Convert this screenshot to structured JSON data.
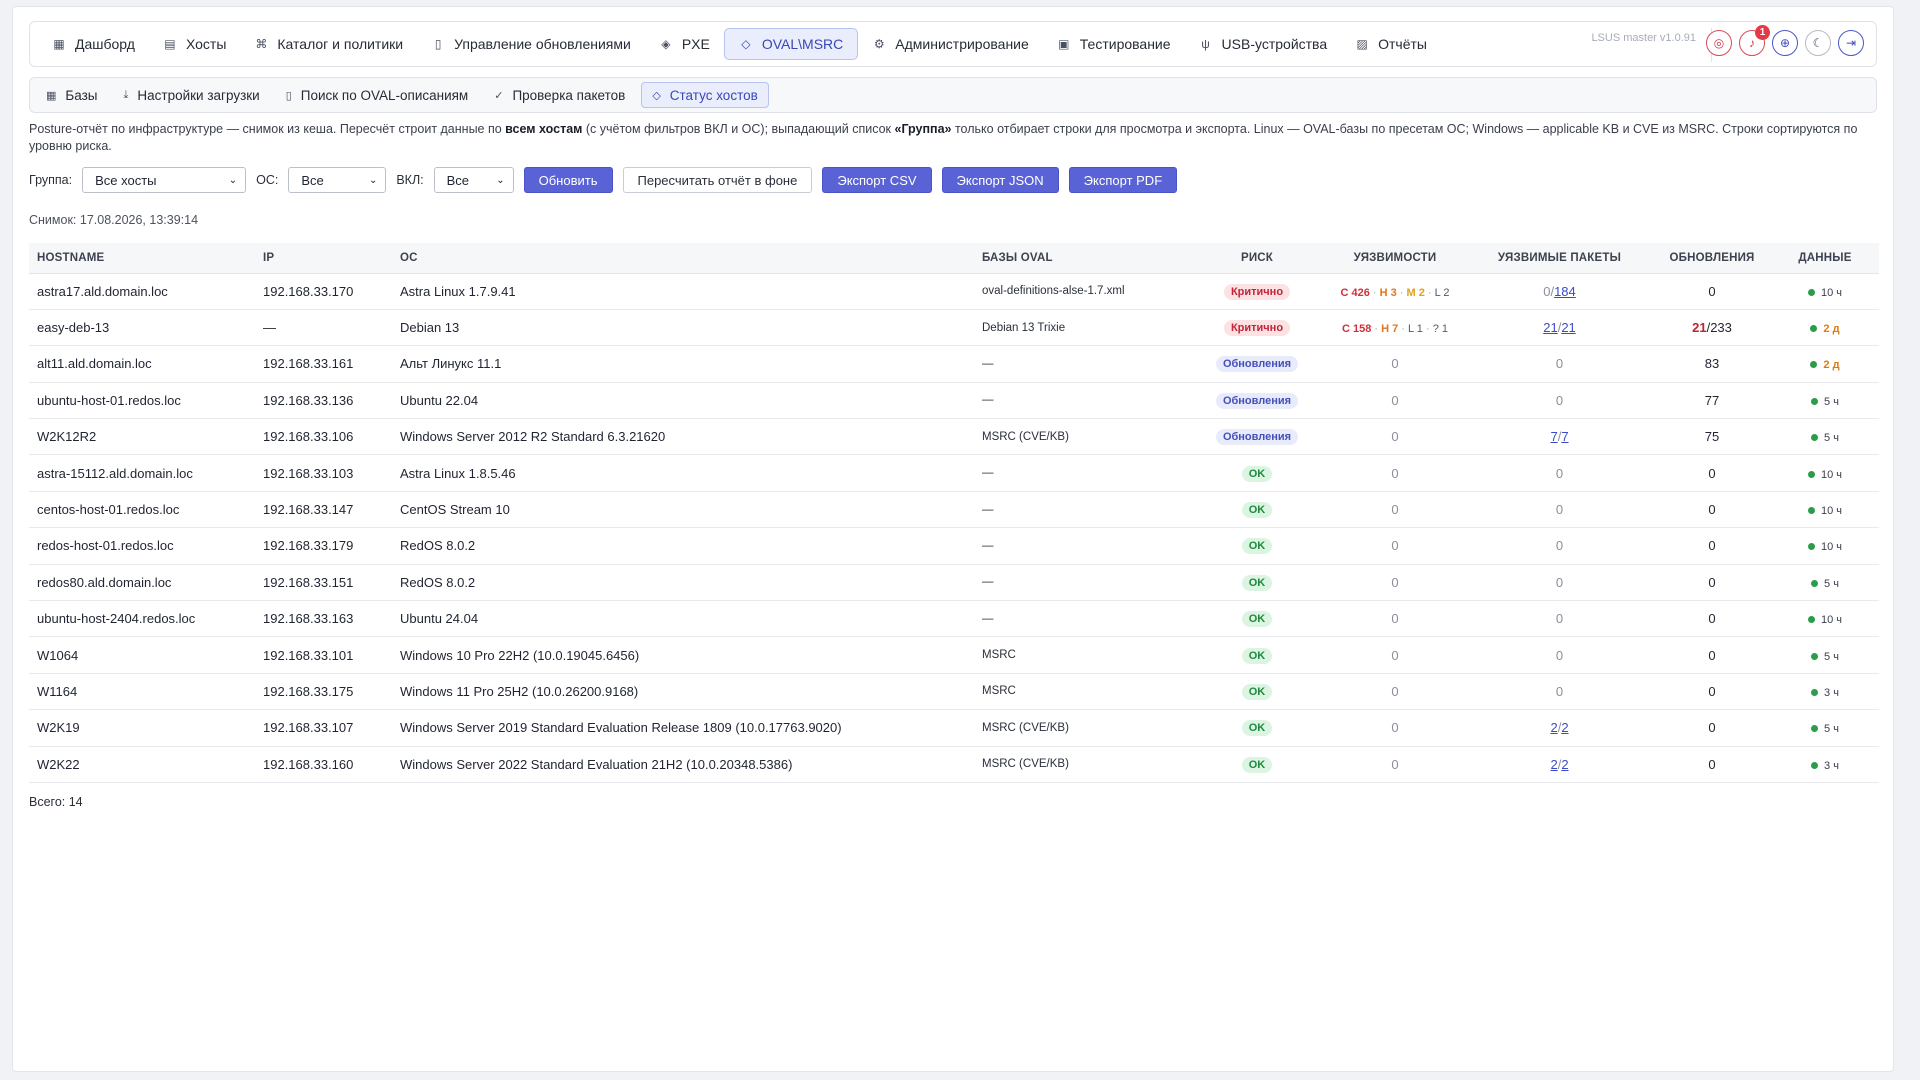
{
  "nav": {
    "items": [
      {
        "label": "Дашборд",
        "icon": "dashboard-icon",
        "glyph": "▦"
      },
      {
        "label": "Хосты",
        "icon": "server-icon",
        "glyph": "▤"
      },
      {
        "label": "Каталог и политики",
        "icon": "catalog-icon",
        "glyph": "⌘"
      },
      {
        "label": "Управление обновлениями",
        "icon": "update-file-icon",
        "glyph": "▯"
      },
      {
        "label": "PXE",
        "icon": "cube-icon",
        "glyph": "◈"
      },
      {
        "label": "OVAL\\MSRC",
        "icon": "shield-icon",
        "glyph": "◇",
        "active": true
      },
      {
        "label": "Администрирование",
        "icon": "admin-gear-icon",
        "glyph": "⚙"
      },
      {
        "label": "Тестирование",
        "icon": "test-icon",
        "glyph": "▣"
      },
      {
        "label": "USB-устройства",
        "icon": "usb-icon",
        "glyph": "ψ"
      },
      {
        "label": "Отчёты",
        "icon": "report-icon",
        "glyph": "▨"
      }
    ],
    "version": "LSUS master v1.0.91",
    "notifications_count": "1"
  },
  "subnav": {
    "items": [
      {
        "label": "Базы",
        "icon": "database-icon",
        "glyph": "▦"
      },
      {
        "label": "Настройки загрузки",
        "icon": "download-icon",
        "glyph": "⤓"
      },
      {
        "label": "Поиск по OVAL-описаниям",
        "icon": "search-doc-icon",
        "glyph": "▯"
      },
      {
        "label": "Проверка пакетов",
        "icon": "check-circle-icon",
        "glyph": "✓"
      },
      {
        "label": "Статус хостов",
        "icon": "shield-small-icon",
        "glyph": "◇",
        "active": true
      }
    ]
  },
  "description": {
    "part1": "Posture-отчёт по инфраструктуре — снимок из кеша. Пересчёт строит данные по ",
    "bold1": "всем хостам",
    "part2": " (с учётом фильтров ВКЛ и ОС); выпадающий список ",
    "bold2": "«Группа»",
    "part3": " только отбирает строки для просмотра и экспорта. Linux — OVAL-базы по пресетам ОС; Windows — applicable KB и CVE из MSRC. Строки сортируются по уровню риска."
  },
  "filters": {
    "group_label": "Группа:",
    "group_value": "Все хосты",
    "os_label": "ОС:",
    "os_value": "Все",
    "vkl_label": "ВКЛ:",
    "vkl_value": "Все",
    "refresh": "Обновить",
    "recalc": "Пересчитать отчёт в фоне",
    "export_csv": "Экспорт CSV",
    "export_json": "Экспорт JSON",
    "export_pdf": "Экспорт PDF"
  },
  "snapshot": "Снимок: 17.08.2026, 13:39:14",
  "table": {
    "headers": [
      "HOSTNAME",
      "IP",
      "ОС",
      "БАЗЫ OVAL",
      "РИСК",
      "УЯЗВИМОСТИ",
      "УЯЗВИМЫЕ ПАКЕТЫ",
      "ОБНОВЛЕНИЯ",
      "ДАННЫЕ"
    ],
    "rows": [
      {
        "host": "astra17.ald.domain.loc",
        "ip": "192.168.33.170",
        "os": "Astra Linux 1.7.9.41",
        "oval": "oval-definitions-alse-1.7.xml",
        "risk": "Критично",
        "risk_type": "crit",
        "vuln": [
          {
            "t": "C 426",
            "c": "vc"
          },
          {
            "t": " · ",
            "c": "sep"
          },
          {
            "t": "H 3",
            "c": "vh"
          },
          {
            "t": " · ",
            "c": "sep"
          },
          {
            "t": "M 2",
            "c": "vm"
          },
          {
            "t": " · ",
            "c": "sep"
          },
          {
            "t": "L 2",
            "c": "vl"
          }
        ],
        "pkg_a": "0",
        "pkg_sep": "/",
        "pkg_b": "184",
        "pkg_a_link": false,
        "pkg_b_link": true,
        "upd_a": "0",
        "upd_b": "",
        "upd_red": false,
        "data": "10 ч",
        "data_warn": false
      },
      {
        "host": "easy-deb-13",
        "ip": "—",
        "os": "Debian 13",
        "oval": "Debian 13 Trixie",
        "risk": "Критично",
        "risk_type": "crit",
        "vuln": [
          {
            "t": "C 158",
            "c": "vc"
          },
          {
            "t": " · ",
            "c": "sep"
          },
          {
            "t": "H 7",
            "c": "vh"
          },
          {
            "t": " · ",
            "c": "sep"
          },
          {
            "t": "L 1",
            "c": "vl"
          },
          {
            "t": " · ",
            "c": "sep"
          },
          {
            "t": "? 1",
            "c": "vl"
          }
        ],
        "pkg_a": "21",
        "pkg_sep": "/",
        "pkg_b": "21",
        "pkg_a_link": true,
        "pkg_b_link": true,
        "upd_a": "21",
        "upd_b": "/233",
        "upd_red": true,
        "data": "2 д",
        "data_warn": true
      },
      {
        "host": "alt11.ald.domain.loc",
        "ip": "192.168.33.161",
        "os": "Альт Линукс 11.1",
        "oval": "—",
        "risk": "Обновления",
        "risk_type": "upd",
        "vuln_zero": "0",
        "pkg_a": "0",
        "pkg_sep": "",
        "pkg_b": "",
        "pkg_zero": true,
        "upd_a": "83",
        "upd_b": "",
        "upd_red": false,
        "data": "2 д",
        "data_warn": true
      },
      {
        "host": "ubuntu-host-01.redos.loc",
        "ip": "192.168.33.136",
        "os": "Ubuntu 22.04",
        "oval": "—",
        "risk": "Обновления",
        "risk_type": "upd",
        "vuln_zero": "0",
        "pkg_a": "0",
        "pkg_sep": "",
        "pkg_b": "",
        "pkg_zero": true,
        "upd_a": "77",
        "upd_b": "",
        "upd_red": false,
        "data": "5 ч",
        "data_warn": false
      },
      {
        "host": "W2K12R2",
        "ip": "192.168.33.106",
        "os": "Windows Server 2012 R2 Standard 6.3.21620",
        "oval": "MSRC (CVE/KB)",
        "risk": "Обновления",
        "risk_type": "upd",
        "vuln_zero": "0",
        "pkg_a": "7",
        "pkg_sep": "/",
        "pkg_b": "7",
        "pkg_a_link": true,
        "pkg_b_link": true,
        "upd_a": "75",
        "upd_b": "",
        "upd_red": false,
        "data": "5 ч",
        "data_warn": false
      },
      {
        "host": "astra-15112.ald.domain.loc",
        "ip": "192.168.33.103",
        "os": "Astra Linux 1.8.5.46",
        "oval": "—",
        "risk": "OK",
        "risk_type": "ok",
        "vuln_zero": "0",
        "pkg_a": "0",
        "pkg_sep": "",
        "pkg_b": "",
        "pkg_zero": true,
        "upd_a": "0",
        "upd_b": "",
        "upd_red": false,
        "data": "10 ч",
        "data_warn": false
      },
      {
        "host": "centos-host-01.redos.loc",
        "ip": "192.168.33.147",
        "os": "CentOS Stream 10",
        "oval": "—",
        "risk": "OK",
        "risk_type": "ok",
        "vuln_zero": "0",
        "pkg_a": "0",
        "pkg_sep": "",
        "pkg_b": "",
        "pkg_zero": true,
        "upd_a": "0",
        "upd_b": "",
        "upd_red": false,
        "data": "10 ч",
        "data_warn": false
      },
      {
        "host": "redos-host-01.redos.loc",
        "ip": "192.168.33.179",
        "os": "RedOS 8.0.2",
        "oval": "—",
        "risk": "OK",
        "risk_type": "ok",
        "vuln_zero": "0",
        "pkg_a": "0",
        "pkg_sep": "",
        "pkg_b": "",
        "pkg_zero": true,
        "upd_a": "0",
        "upd_b": "",
        "upd_red": false,
        "data": "10 ч",
        "data_warn": false
      },
      {
        "host": "redos80.ald.domain.loc",
        "ip": "192.168.33.151",
        "os": "RedOS 8.0.2",
        "oval": "—",
        "risk": "OK",
        "risk_type": "ok",
        "vuln_zero": "0",
        "pkg_a": "0",
        "pkg_sep": "",
        "pkg_b": "",
        "pkg_zero": true,
        "upd_a": "0",
        "upd_b": "",
        "upd_red": false,
        "data": "5 ч",
        "data_warn": false
      },
      {
        "host": "ubuntu-host-2404.redos.loc",
        "ip": "192.168.33.163",
        "os": "Ubuntu 24.04",
        "oval": "—",
        "risk": "OK",
        "risk_type": "ok",
        "vuln_zero": "0",
        "pkg_a": "0",
        "pkg_sep": "",
        "pkg_b": "",
        "pkg_zero": true,
        "upd_a": "0",
        "upd_b": "",
        "upd_red": false,
        "data": "10 ч",
        "data_warn": false
      },
      {
        "host": "W1064",
        "ip": "192.168.33.101",
        "os": "Windows 10 Pro 22H2 (10.0.19045.6456)",
        "oval": "MSRC",
        "risk": "OK",
        "risk_type": "ok",
        "vuln_zero": "0",
        "pkg_a": "0",
        "pkg_sep": "",
        "pkg_b": "",
        "pkg_zero": true,
        "upd_a": "0",
        "upd_b": "",
        "upd_red": false,
        "data": "5 ч",
        "data_warn": false
      },
      {
        "host": "W1164",
        "ip": "192.168.33.175",
        "os": "Windows 11 Pro 25H2 (10.0.26200.9168)",
        "oval": "MSRC",
        "risk": "OK",
        "risk_type": "ok",
        "vuln_zero": "0",
        "pkg_a": "0",
        "pkg_sep": "",
        "pkg_b": "",
        "pkg_zero": true,
        "upd_a": "0",
        "upd_b": "",
        "upd_red": false,
        "data": "3 ч",
        "data_warn": false
      },
      {
        "host": "W2K19",
        "ip": "192.168.33.107",
        "os": "Windows Server 2019 Standard Evaluation Release 1809 (10.0.17763.9020)",
        "oval": "MSRC (CVE/KB)",
        "risk": "OK",
        "risk_type": "ok",
        "vuln_zero": "0",
        "pkg_a": "2",
        "pkg_sep": "/",
        "pkg_b": "2",
        "pkg_a_link": true,
        "pkg_b_link": true,
        "upd_a": "0",
        "upd_b": "",
        "upd_red": false,
        "data": "5 ч",
        "data_warn": false
      },
      {
        "host": "W2K22",
        "ip": "192.168.33.160",
        "os": "Windows Server 2022 Standard Evaluation 21H2 (10.0.20348.5386)",
        "oval": "MSRC (CVE/KB)",
        "risk": "OK",
        "risk_type": "ok",
        "vuln_zero": "0",
        "pkg_a": "2",
        "pkg_sep": "/",
        "pkg_b": "2",
        "pkg_a_link": true,
        "pkg_b_link": true,
        "upd_a": "0",
        "upd_b": "",
        "upd_red": false,
        "data": "3 ч",
        "data_warn": false
      }
    ]
  },
  "total": "Всего: 14"
}
